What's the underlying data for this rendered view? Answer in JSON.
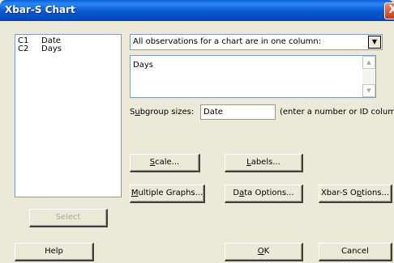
{
  "window": {
    "title": "Xbar-S Chart",
    "close_glyph": "X"
  },
  "variables": [
    {
      "column": "C1",
      "name": "Date"
    },
    {
      "column": "C2",
      "name": "Days"
    }
  ],
  "data_arrangement": {
    "selected": "All observations for a chart are in one column:",
    "arrow_icon": "dropdown-arrow-icon"
  },
  "variables_field": {
    "value": "Days"
  },
  "subgroup": {
    "label_pre": "S",
    "label_ul": "u",
    "label_post": "bgroup sizes:",
    "value": "Date",
    "hint": "(enter a number or ID column)"
  },
  "buttons": {
    "scale": {
      "ul": "S",
      "rest": "cale..."
    },
    "labels": {
      "ul": "L",
      "rest": "abels..."
    },
    "multiple_graphs": {
      "ul": "M",
      "rest": "ultiple Graphs..."
    },
    "data_options": {
      "pre": "D",
      "ul": "a",
      "rest": "ta Options..."
    },
    "xbar_s_options": {
      "pre": "Xbar-S O",
      "ul": "p",
      "rest": "tions..."
    },
    "select": {
      "label": "Select"
    },
    "help": {
      "label": "Help"
    },
    "ok": {
      "ul": "O",
      "rest": "K"
    },
    "cancel": {
      "label": "Cancel"
    }
  }
}
